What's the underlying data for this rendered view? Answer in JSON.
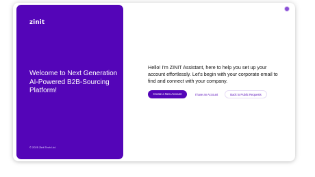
{
  "brand": {
    "logo_text": "zinit",
    "accent_color": "#5405b8"
  },
  "left_panel": {
    "welcome_text": "Welcome to Next Generation AI-Powered B2B-Sourcing Platform!",
    "copyright": "© 2025 Zinit Tech Ltd."
  },
  "header": {
    "avatar_icon": "user-avatar-icon"
  },
  "main": {
    "assistant_message": "Hello! I'm ZINIT Assistant, here to help you set up your account effortlessly. Let's begin with your corporate email to find and connect with your company.",
    "buttons": {
      "create_account": "Create a New Account",
      "have_account": "I have an Account",
      "back_requests": "Back to Public Requests"
    }
  }
}
